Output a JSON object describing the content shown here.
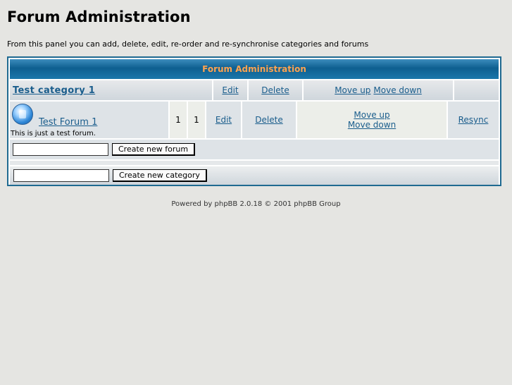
{
  "page": {
    "title": "Forum Administration",
    "intro": "From this panel you can add, delete, edit, re-order and re-synchronise categories and forums"
  },
  "table": {
    "header": "Forum Administration",
    "category": {
      "name": "Test category 1",
      "edit": "Edit",
      "delete": "Delete",
      "move_up": "Move up",
      "move_down": "Move down"
    },
    "forum": {
      "name": "Test Forum 1",
      "description": "This is just a test forum.",
      "topics": "1",
      "posts": "1",
      "edit": "Edit",
      "delete": "Delete",
      "move_up": "Move up",
      "move_down": "Move down",
      "resync": "Resync",
      "icon": "forum-folder-icon"
    },
    "new_forum": {
      "value": "",
      "button": "Create new forum"
    },
    "new_category": {
      "value": "",
      "button": "Create new category"
    }
  },
  "footer": "Powered by phpBB 2.0.18 © 2001 phpBB Group",
  "colors": {
    "background": "#e5e5e2",
    "header_text": "#ffa34f",
    "header_bg": "#0e5f90",
    "link": "#1a5d8c",
    "border": "#1f6a91"
  }
}
